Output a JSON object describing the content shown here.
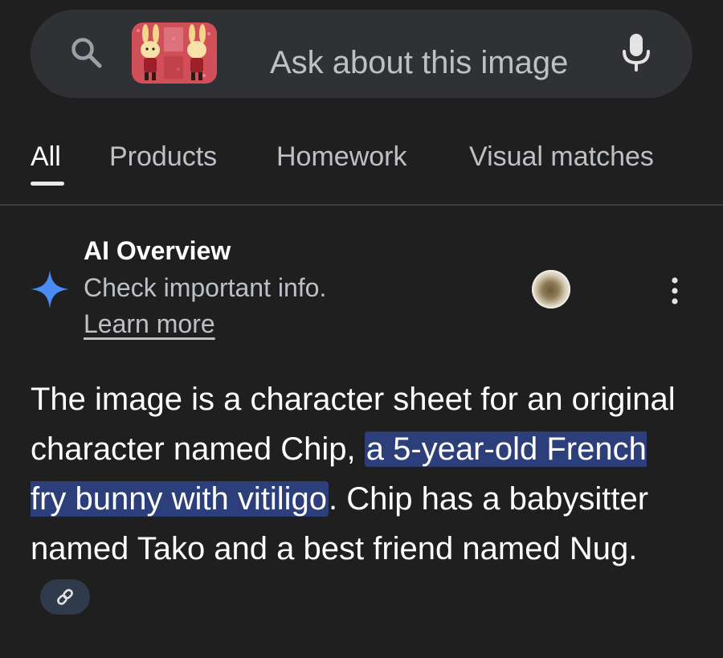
{
  "search": {
    "placeholder": "Ask about this image",
    "icons": {
      "search": "search-icon",
      "microphone": "mic-icon"
    }
  },
  "tabs": [
    {
      "label": "All",
      "active": true
    },
    {
      "label": "Products",
      "active": false
    },
    {
      "label": "Homework",
      "active": false
    },
    {
      "label": "Visual matches",
      "active": false
    }
  ],
  "ai_overview": {
    "title": "AI Overview",
    "subtitle": "Check important info.",
    "learn_more": "Learn more",
    "icons": {
      "badge": "sparkle-icon",
      "menu": "more-vert-icon"
    }
  },
  "overview": {
    "text_before": "The image is a character sheet for an original character named Chip, ",
    "highlight": "a 5-year-old French fry bunny with vitiligo",
    "text_after": ". Chip has a babysitter named Tako and a best friend named Nug.",
    "link_icon": "link-icon"
  },
  "colors": {
    "background": "#1f1f1f",
    "search_bar": "#303134",
    "highlight": "#2d3f7a",
    "accent_blue": "#4a8cf7"
  }
}
